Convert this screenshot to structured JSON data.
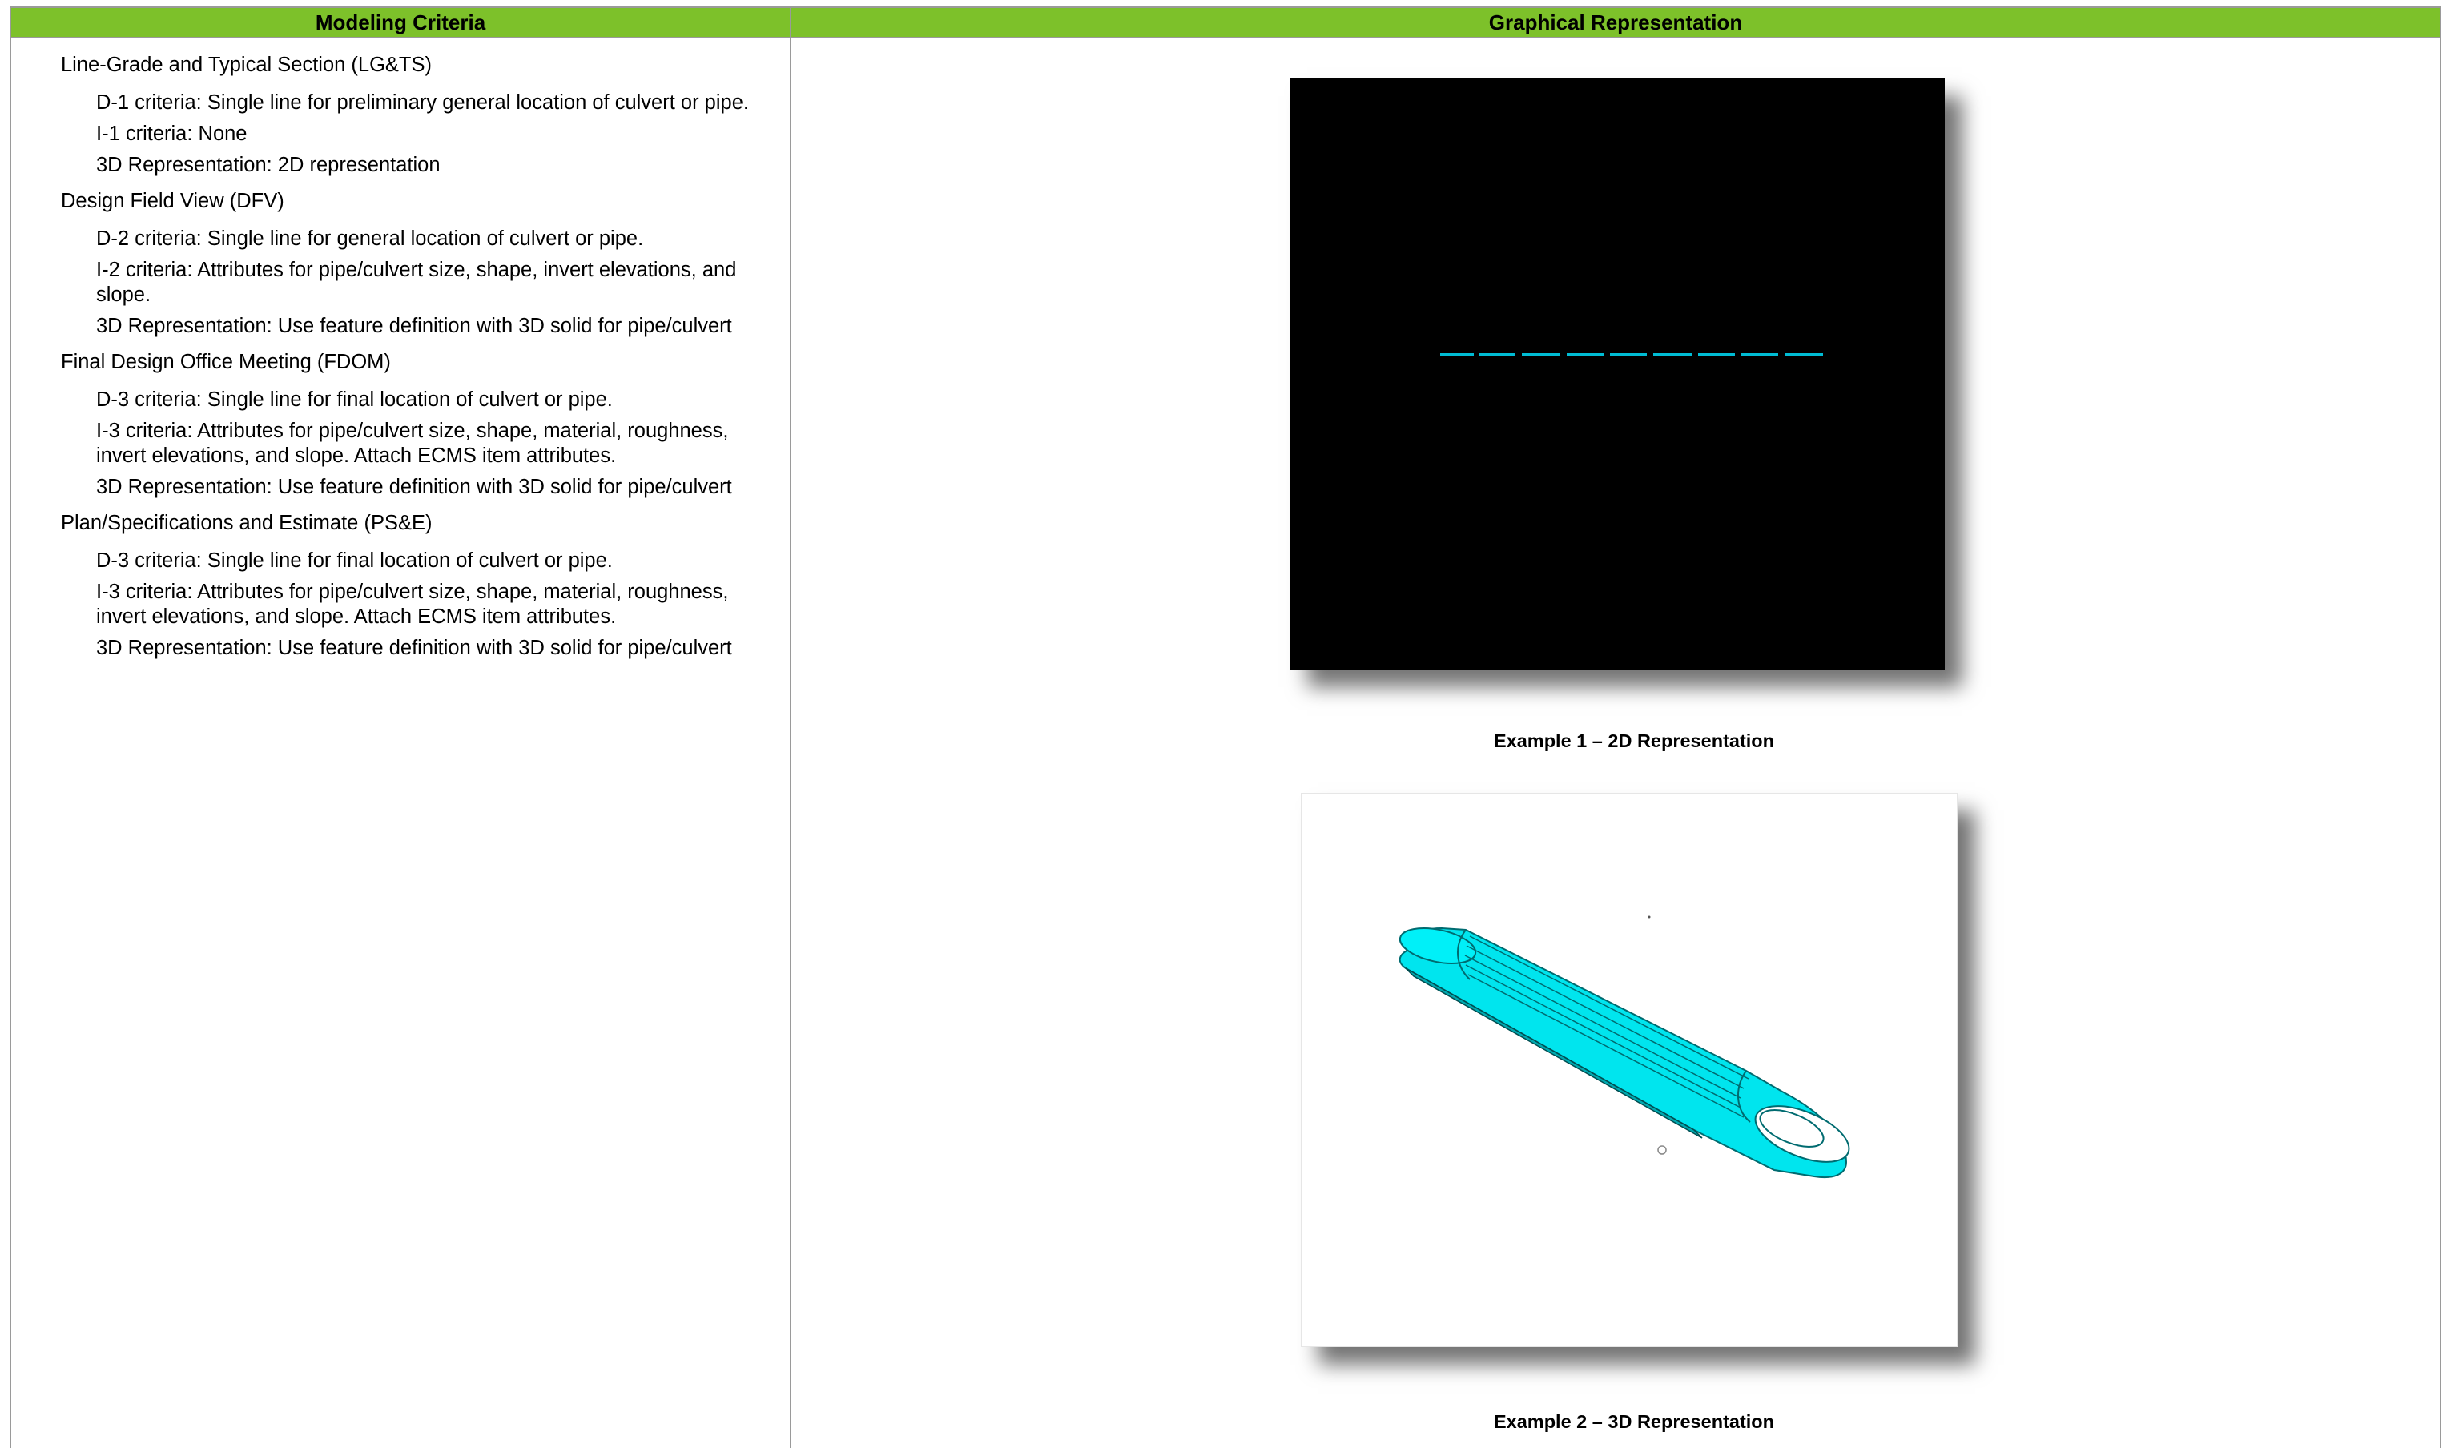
{
  "table": {
    "headers": {
      "left": "Modeling Criteria",
      "right": "Graphical Representation"
    }
  },
  "criteria": [
    {
      "title": "Line-Grade and Typical Section (LG&TS)",
      "items": [
        "D-1 criteria: Single line for preliminary general location of culvert or pipe.",
        "I-1 criteria: None",
        "3D Representation: 2D representation"
      ]
    },
    {
      "title": "Design Field View (DFV)",
      "items": [
        "D-2 criteria: Single line for general location of culvert or pipe.",
        "I-2 criteria: Attributes for pipe/culvert size, shape, invert elevations, and slope.",
        "3D Representation: Use feature definition with 3D solid for pipe/culvert"
      ]
    },
    {
      "title": "Final Design Office Meeting (FDOM)",
      "items": [
        "D-3 criteria: Single line for final location of culvert or pipe.",
        "I-3 criteria: Attributes for pipe/culvert size, shape, material, roughness, invert elevations, and slope. Attach ECMS item attributes.",
        "3D Representation: Use feature definition with 3D solid for pipe/culvert"
      ]
    },
    {
      "title": "Plan/Specifications and Estimate (PS&E)",
      "items": [
        "D-3 criteria: Single line for final location of culvert or pipe.",
        "I-3 criteria: Attributes for pipe/culvert size, shape, material, roughness, invert elevations, and slope. Attach ECMS item attributes.",
        "3D Representation: Use feature definition with 3D solid for pipe/culvert"
      ]
    }
  ],
  "examples": [
    {
      "caption": "Example 1 – 2D Representation"
    },
    {
      "caption": "Example 2 – 3D Representation"
    }
  ],
  "colors": {
    "header_green": "#7dc12a",
    "pipe_cyan": "#00e5ee",
    "line_cyan": "#00bcd4",
    "border_gray": "#9a9a9a"
  }
}
